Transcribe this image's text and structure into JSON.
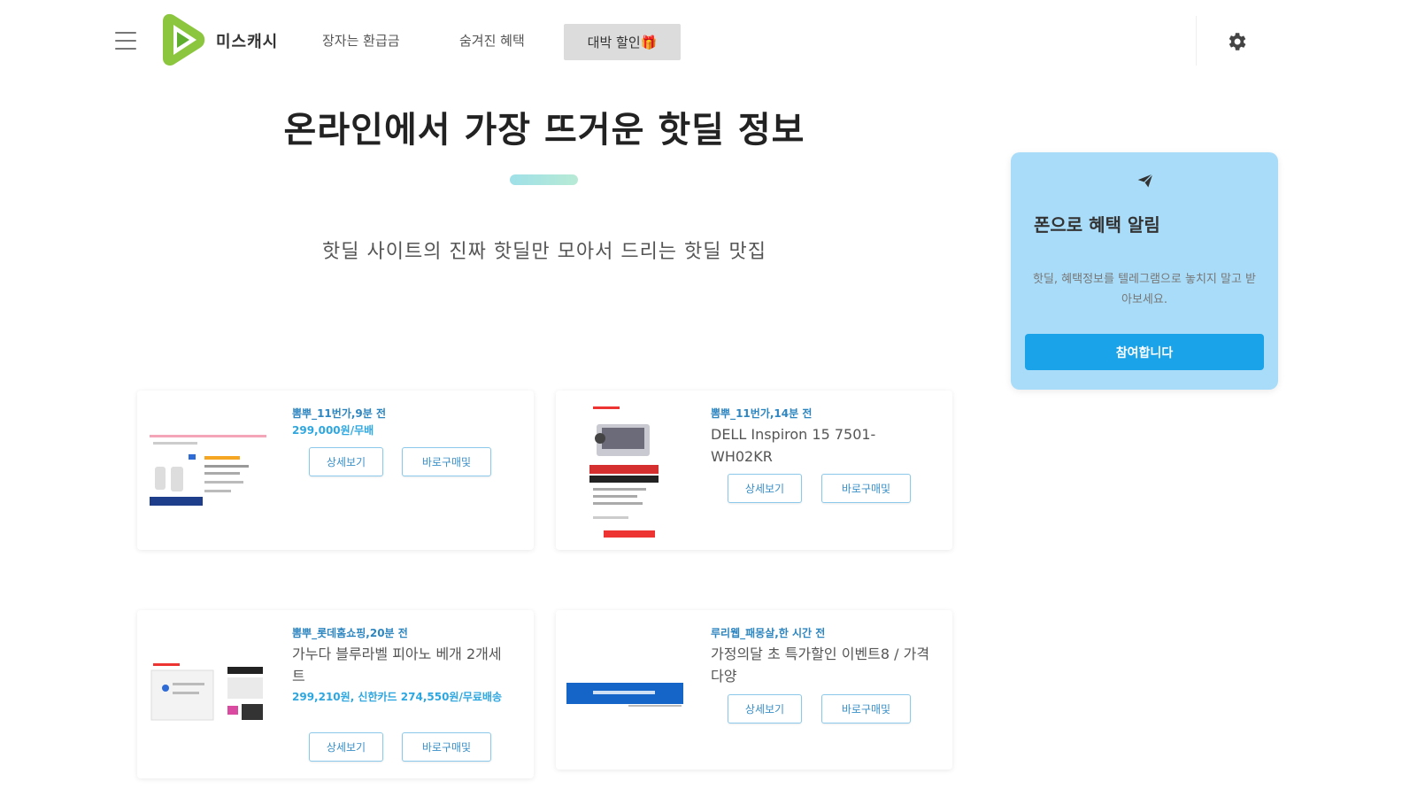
{
  "header": {
    "brand": "미스캐시",
    "nav": [
      "장자는 환급금",
      "숨겨진 혜택"
    ],
    "active_nav": "대박 할인🎁"
  },
  "hero": {
    "title": "온라인에서 가장 뜨거운 핫딜 정보",
    "subtitle": "핫딜 사이트의 진짜 핫딜만 모아서 드리는 핫딜 맛집"
  },
  "side": {
    "title": "폰으로 혜택 알림",
    "desc": "핫딜, 혜택정보를 텔레그램으로 놓치지 말고 받아보세요.",
    "button": "참여합니다"
  },
  "deals": [
    {
      "meta": "뽐뿌_11번가,9분 전",
      "title": "",
      "price": "299,000원/무배",
      "detail_btn": "상세보기",
      "buy_btn": "바로구매및"
    },
    {
      "meta": "뽐뿌_11번가,14분 전",
      "title": "DELL Inspiron 15 7501-WH02KR",
      "price": "",
      "detail_btn": "상세보기",
      "buy_btn": "바로구매및"
    },
    {
      "meta": "뽐뿌_롯데홈쇼핑,20분 전",
      "title": "가누다 블루라벨 피아노 베개 2개세트",
      "price": "299,210원, 신한카드 274,550원/무료배송",
      "detail_btn": "상세보기",
      "buy_btn": "바로구매및"
    },
    {
      "meta": "루리웹_패몽살,한 시간 전",
      "title": "가정의달 초 특가할인 이벤트8 / 가격 다양",
      "price": "",
      "detail_btn": "상세보기",
      "buy_btn": "바로구매및"
    }
  ],
  "colors": {
    "accent": "#1aa3e8",
    "side_card_bg": "#a9dcf8",
    "meta_text": "#2e86c1",
    "logo_green": "#8cc63f"
  }
}
